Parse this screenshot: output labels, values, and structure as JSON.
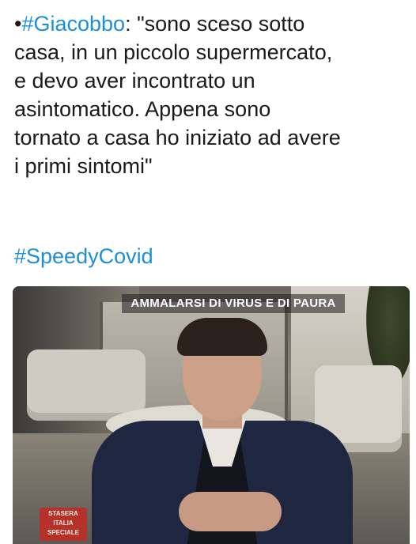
{
  "tweet": {
    "lines": [
      "•#Giacobbo: \"sono sceso sotto",
      "casa, in un piccolo supermercato,",
      "e devo aver incontrato un",
      "asintomatico. Appena sono",
      "tornato a casa ho iniziato ad avere",
      "i primi sintomi\""
    ],
    "bullet": "•",
    "hashtag_name": "#Giacobbo",
    "line1_rest": ": \"sono sceso sotto",
    "hashtag2": "#SpeedyCovid",
    "hashtag_color": "#1d8fd6"
  },
  "image": {
    "banner_text": "AMMALARSI DI VIRUS E DI PAURA",
    "logo_lines": [
      "STASERA",
      "ITALIA",
      "SPECIALE"
    ]
  }
}
